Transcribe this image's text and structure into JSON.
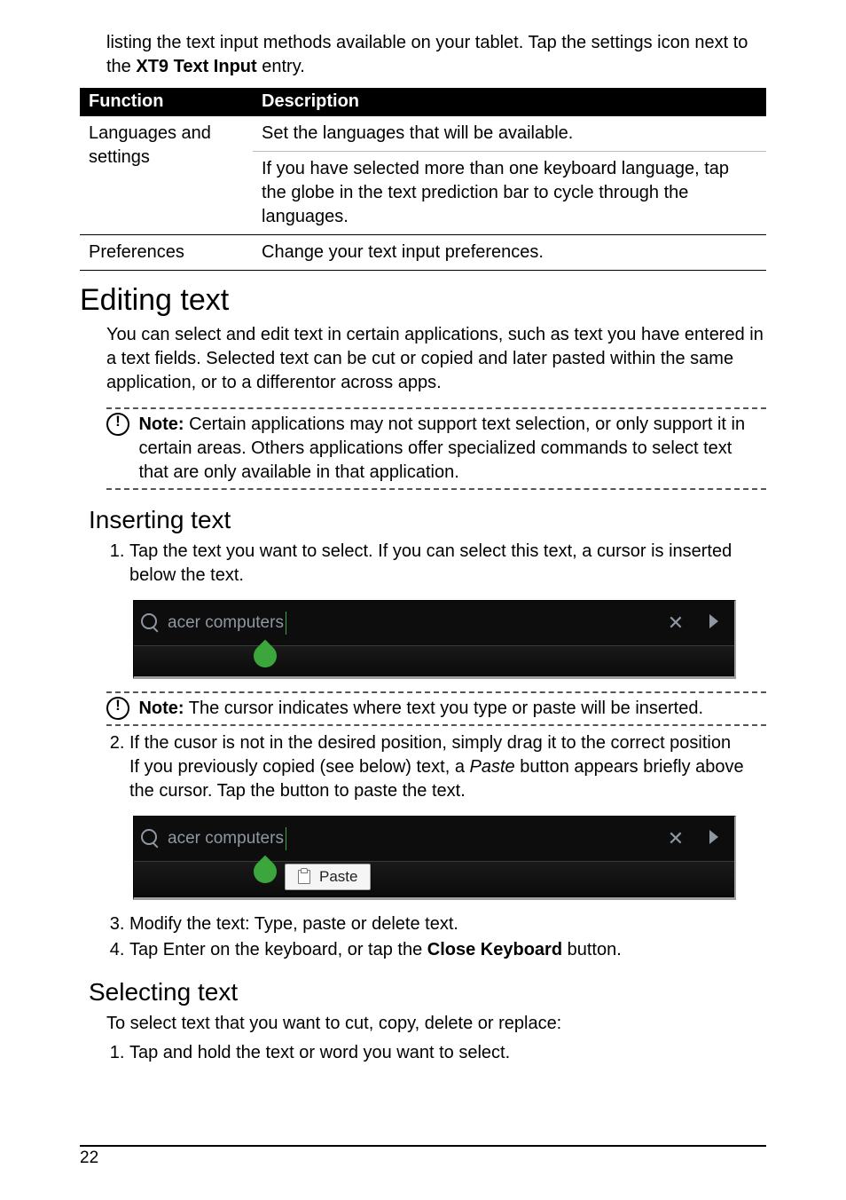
{
  "intro": {
    "line1": "listing the text input methods available on your tablet. Tap the settings icon next to the ",
    "bold_entry": "XT9 Text Input",
    "line2": " entry."
  },
  "table": {
    "headers": {
      "col1": "Function",
      "col2": "Description"
    },
    "row1": {
      "fn_line1": "Languages and",
      "fn_line2": "settings",
      "desc1": "Set the languages that will be available.",
      "desc2": "If you have selected more than one keyboard language, tap the globe in the text prediction bar to cycle through the languages."
    },
    "row2": {
      "fn": "Preferences",
      "desc": "Change your text input preferences."
    }
  },
  "h1_editing": "Editing text",
  "editing_para": "You can select and edit text in certain applications, such as text you have entered in a text fields. Selected text can be cut or copied and later pasted within the same application, or to a differentor across apps.",
  "note1": {
    "label": "Note:",
    "body": " Certain applications may not support text selection, or only support it in certain areas. Others applications offer specialized commands to select text that are only available in that application."
  },
  "h2_inserting": "Inserting text",
  "ol_inserting": {
    "item1": "Tap the text you want to select. If you can select this text, a cursor is inserted below the text."
  },
  "screenshot1": {
    "search_text": "acer computers"
  },
  "note2": {
    "label": "Note:",
    "body": " The cursor indicates where text you type or paste will be inserted."
  },
  "ol_inserting2": {
    "item2a": "If the cusor is not in the desired position, simply drag it to the correct position",
    "item2b_pre": "If you previously copied (see below) text, a ",
    "item2b_italic": "Paste",
    "item2b_post": " button appears briefly above the cursor. Tap the button to paste the text."
  },
  "screenshot2": {
    "search_text": "acer computers",
    "paste_label": "Paste"
  },
  "ol_inserting3": {
    "item3": "Modify the text: Type, paste or delete text.",
    "item4_pre": "Tap Enter on the keyboard, or tap the ",
    "item4_bold": "Close Keyboard",
    "item4_post": " button."
  },
  "h2_selecting": "Selecting text",
  "selecting_para": "To select text that you want to cut, copy, delete or replace:",
  "ol_selecting": {
    "item1": "Tap and hold the text or word you want to select."
  },
  "page_number": "22"
}
